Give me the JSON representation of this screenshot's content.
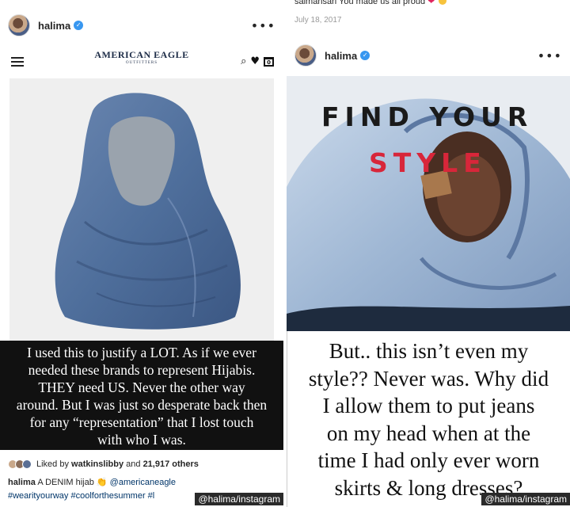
{
  "left_post": {
    "username": "halima",
    "more_label": "•••",
    "verified_icon": "verified-badge-icon",
    "shop": {
      "brand_title": "AMERICAN EAGLE",
      "brand_sub": "OUTFITTERS",
      "bag_count": "0"
    },
    "caption_lines": [
      "I used this to justify a LOT.  As if we ever",
      "needed these brands to represent Hijabis.",
      "THEY need US. Never the other way",
      "around. But I was just so desperate back then",
      "for any “representation” that I lost touch",
      "with who I was."
    ],
    "likes": {
      "prefix": "Liked by",
      "user": "watkinslibby",
      "middle": "and",
      "count": "21,917 others"
    },
    "post_caption": {
      "user": "halima",
      "text": "A DENIM hijab",
      "mention": "@americaneagle"
    },
    "hashtags": "#wearityourway #coolforthesummer #l",
    "credit": "@halima/instagram"
  },
  "right_post": {
    "top_comment": "salmansari You made us all proud",
    "top_comment_emoji": "❤",
    "date": "July 18, 2017",
    "username": "halima",
    "more_label": "•••",
    "overlay_line1": "FIND YOUR",
    "overlay_line2": "STYLE",
    "caption_lines": [
      "But.. this isn’t even my",
      "style?? Never was. Why did",
      "I allow them to put jeans",
      "on my head when at the",
      "time I had only ever worn",
      "skirts & long dresses?"
    ],
    "credit": "@halima/instagram"
  },
  "colors": {
    "ig_blue": "#3897f0",
    "style_red": "#d8263a",
    "denim": "#4f6f9c"
  }
}
